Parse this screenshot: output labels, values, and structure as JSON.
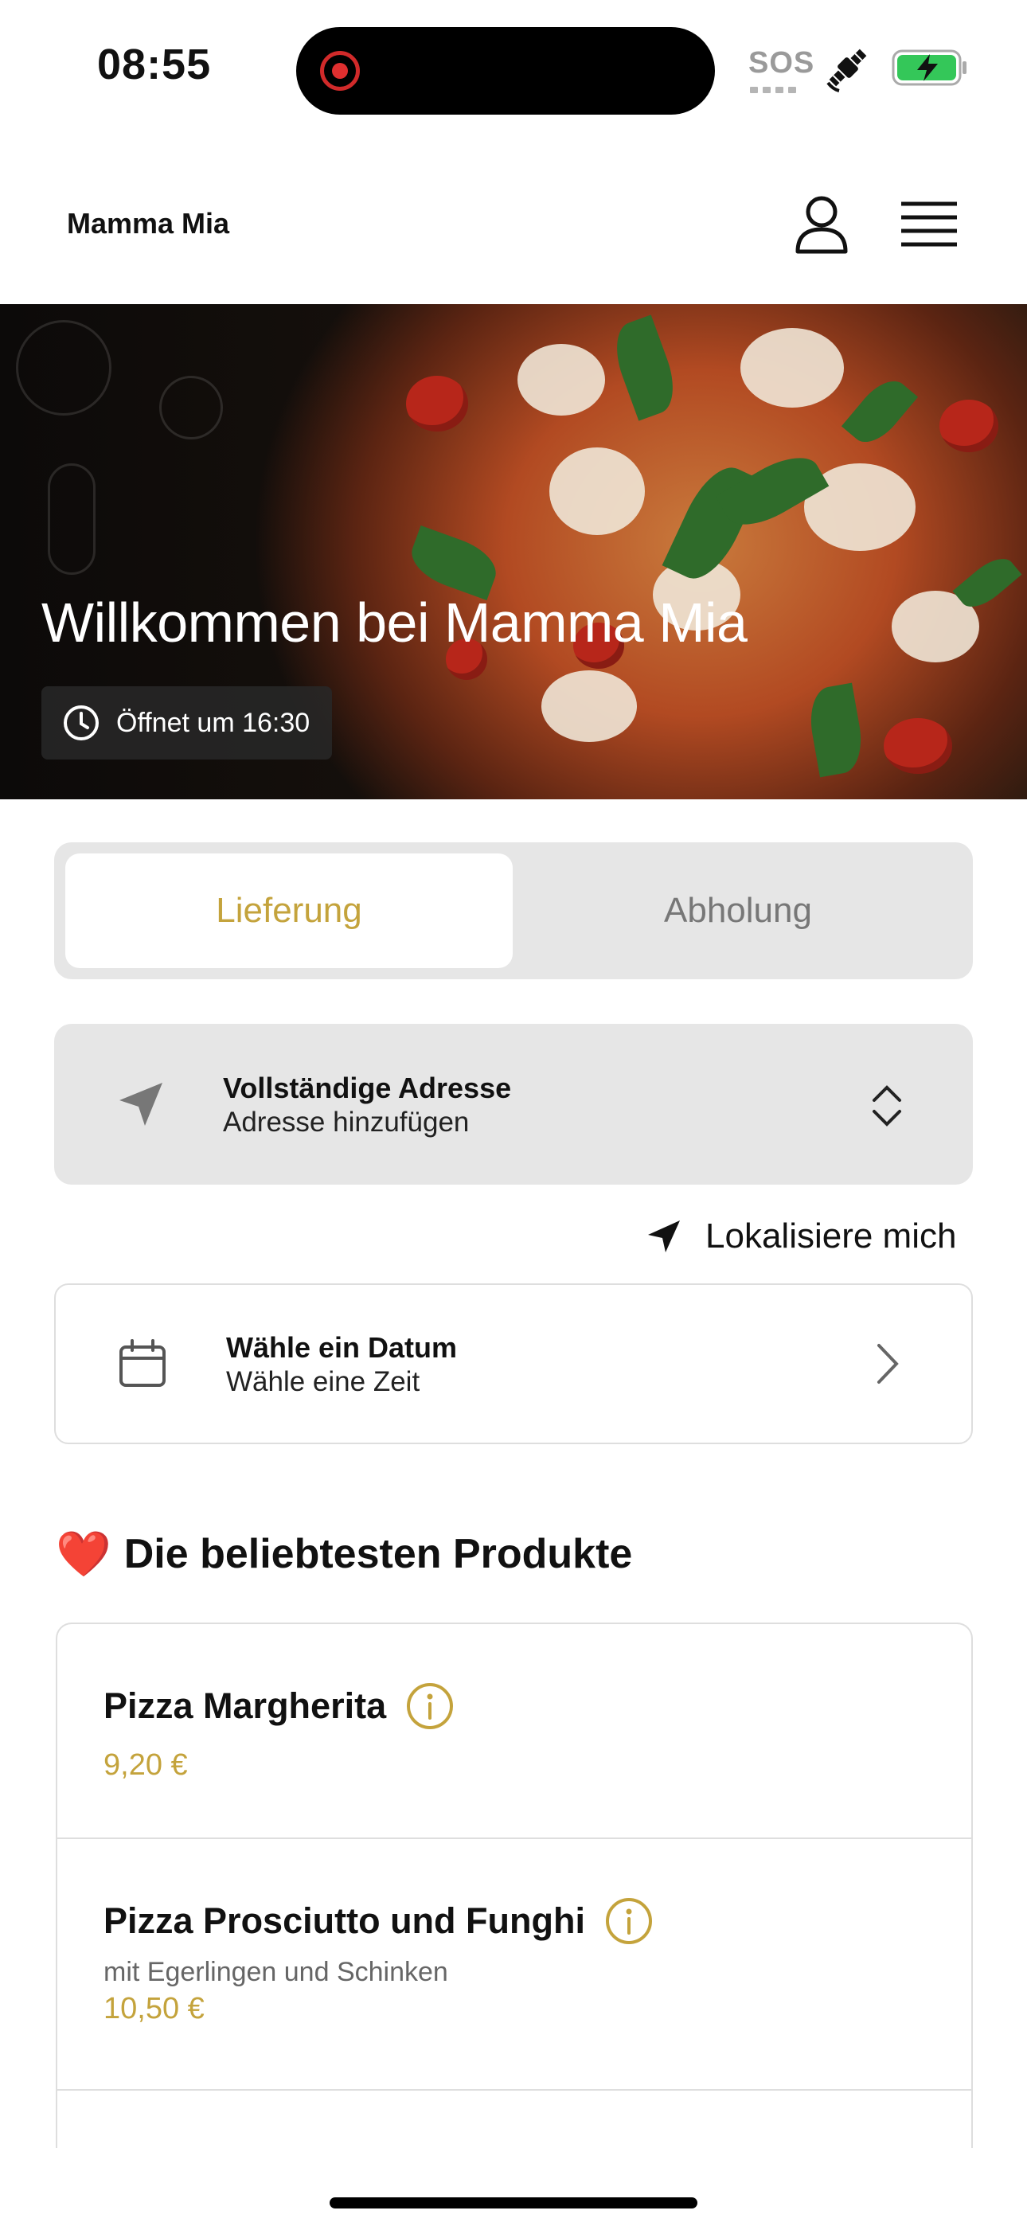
{
  "status_bar": {
    "time": "08:55",
    "sos": "SOS",
    "icons": [
      "recording-indicator",
      "satellite-icon",
      "battery-charging-icon"
    ],
    "battery_color": "#34c759"
  },
  "header": {
    "brand": "Mamma Mia",
    "icons": [
      "user-icon",
      "hamburger-menu-icon"
    ]
  },
  "hero": {
    "title": "Willkommen bei Mamma Mia",
    "opening": "Öffnet um 16:30",
    "icon": "clock-icon"
  },
  "order_mode": {
    "options": [
      "Lieferung",
      "Abholung"
    ],
    "selected": "Lieferung"
  },
  "address": {
    "title": "Vollständige Adresse",
    "subtitle": "Adresse hinzufügen",
    "icon": "location-arrow-icon"
  },
  "locate_me": {
    "label": "Lokalisiere mich",
    "icon": "navigation-arrow-icon"
  },
  "date_time": {
    "title": "Wähle ein Datum",
    "subtitle": "Wähle eine Zeit",
    "icon": "calendar-icon"
  },
  "popular": {
    "title": "Die beliebtesten Produkte",
    "emoji": "❤️",
    "products": [
      {
        "name": "Pizza Margherita",
        "description": "",
        "price": "9,20 €"
      },
      {
        "name": "Pizza Prosciutto und Funghi",
        "description": "mit Egerlingen und Schinken",
        "price": "10,50 €"
      }
    ]
  },
  "colors": {
    "accent": "#c4a33c",
    "segment_bg": "#e6e6e6",
    "border": "#dedede"
  }
}
